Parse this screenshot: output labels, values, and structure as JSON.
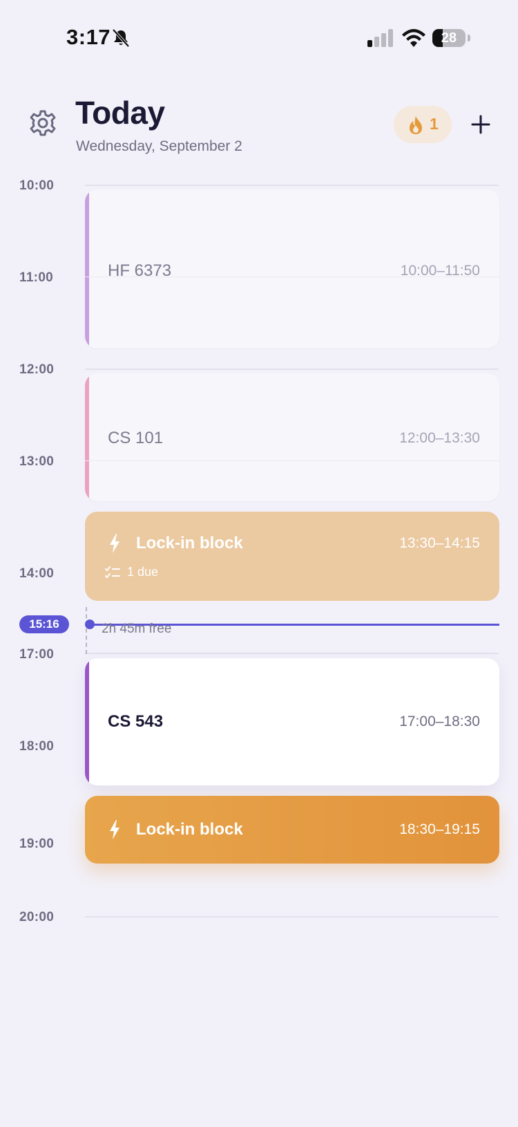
{
  "status_bar": {
    "time": "3:17",
    "battery": "28",
    "icons": [
      "bell-slash-icon",
      "cellular-signal-icon",
      "wifi-icon",
      "battery-icon"
    ]
  },
  "header": {
    "title": "Today",
    "date": "Wednesday, September 2",
    "streak_count": "1",
    "icons": [
      "gear-icon",
      "flame-icon",
      "plus-icon"
    ]
  },
  "timeline": {
    "hours": [
      "10:00",
      "11:00",
      "12:00",
      "13:00",
      "14:00",
      "17:00",
      "18:00",
      "19:00",
      "20:00"
    ],
    "now_label": "15:16",
    "free_gap": "2h 45m free"
  },
  "events": [
    {
      "name": "HF 6373",
      "time": "10:00–11:50",
      "state": "past",
      "accent": "#c79fe0"
    },
    {
      "name": "CS 101",
      "time": "12:00–13:30",
      "state": "past",
      "accent": "#eaa2c0"
    },
    {
      "name": "Lock-in block",
      "time": "13:30–14:15",
      "state": "past-lock",
      "due": "1 due"
    },
    {
      "name": "CS 543",
      "time": "17:00–18:30",
      "state": "current",
      "accent": "#9b55c9"
    },
    {
      "name": "Lock-in block",
      "time": "18:30–19:15",
      "state": "upcoming-lock"
    }
  ],
  "colors": {
    "background": "#f2f1f9",
    "now_indicator": "#5b55d6",
    "lock_block": "#e39a42",
    "streak_flame": "#e59a3b"
  }
}
